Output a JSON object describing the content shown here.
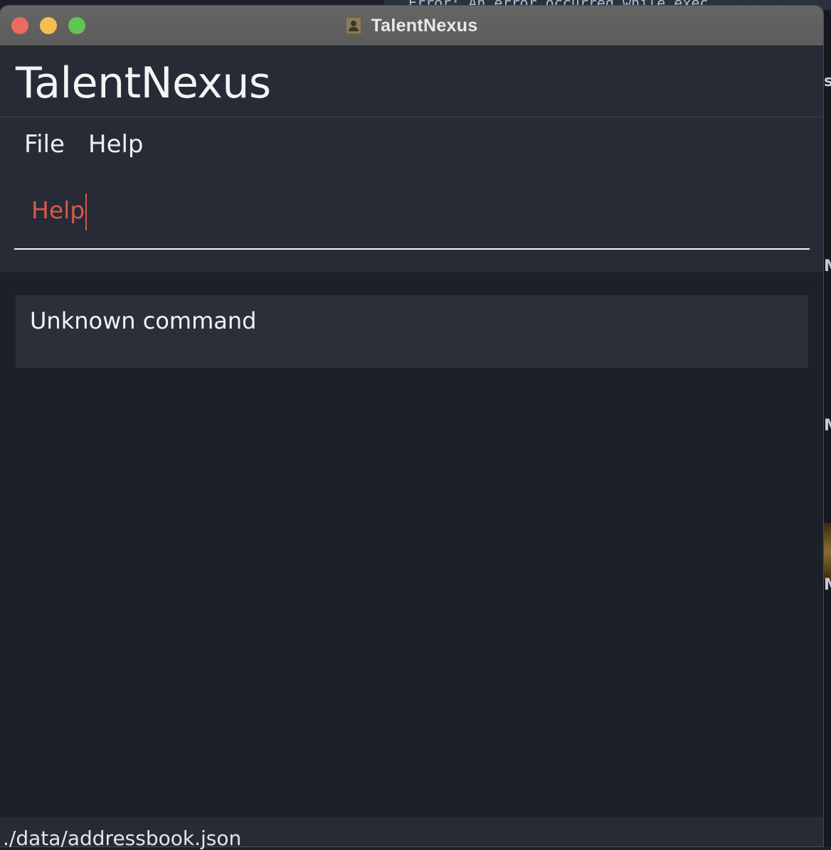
{
  "window": {
    "title": "TalentNexus"
  },
  "app": {
    "name": "TalentNexus"
  },
  "menu": {
    "items": [
      {
        "label": "File"
      },
      {
        "label": "Help"
      }
    ]
  },
  "command_box": {
    "value": "Help",
    "text_color": "#d9574b"
  },
  "result_display": {
    "message": "Unknown command"
  },
  "status_bar": {
    "file_path": "./data/addressbook.json"
  },
  "background": {
    "terminal_text": "Error: An error occurred while exec"
  },
  "colors": {
    "close": "#ed6a5e",
    "minimize": "#f5bf4f",
    "zoom": "#61c554",
    "panel": "#262b36",
    "background": "#1c2129"
  },
  "icons": {
    "app": "contacts-book-icon"
  }
}
